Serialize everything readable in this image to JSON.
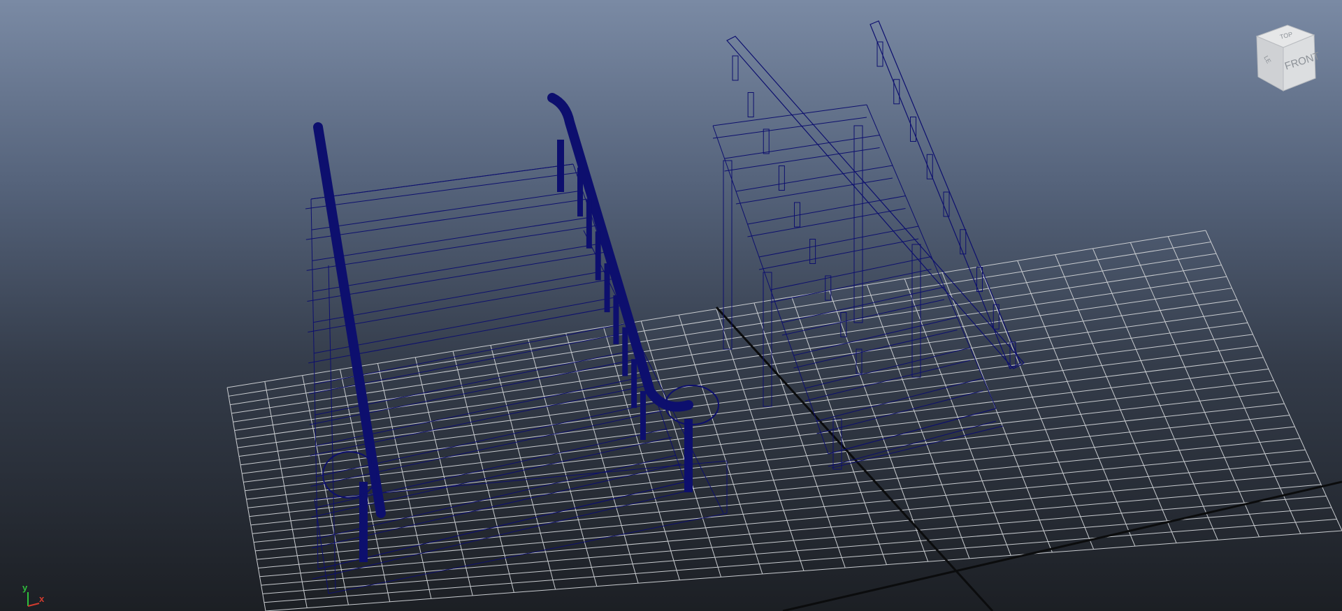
{
  "viewport": {
    "view_cube": {
      "top_label": "TOP",
      "front_label": "FRONT",
      "left_label": "LE"
    },
    "axis_indicator": {
      "y_label": "y",
      "x_label": "x"
    }
  },
  "scene": {
    "grid_color": "#c9ccd0",
    "wire_color": "#0d0f6e",
    "origin_axis_color": "#0b0c0d",
    "objects": [
      "staircase-with-round-handrails",
      "staircase-with-square-railings"
    ]
  },
  "colors": {
    "sky_top": "#7a8aa4",
    "sky_bottom": "#1c1f24",
    "axis_y": "#2fbf3c",
    "axis_x": "#d23b2e"
  }
}
